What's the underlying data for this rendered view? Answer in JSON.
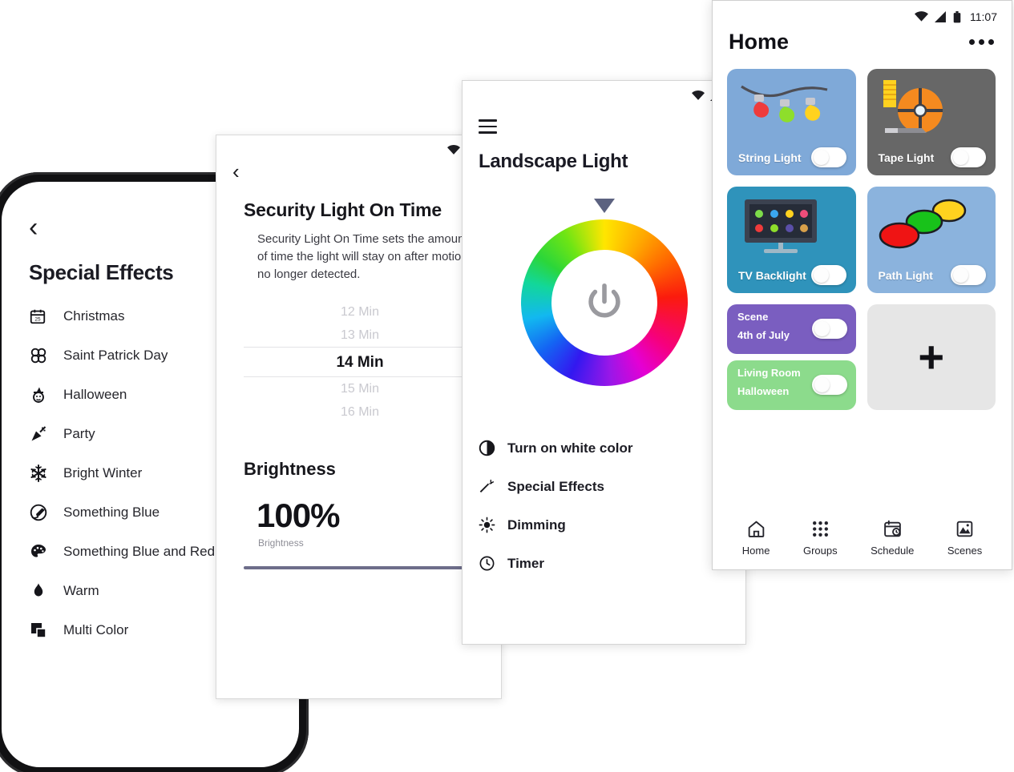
{
  "effects_screen": {
    "back_icon": "chevron-left-icon",
    "title": "Special Effects",
    "items": [
      {
        "icon": "calendar-icon",
        "label": "Christmas"
      },
      {
        "icon": "clover-icon",
        "label": "Saint Patrick Day"
      },
      {
        "icon": "witch-icon",
        "label": "Halloween"
      },
      {
        "icon": "party-popper-icon",
        "label": "Party"
      },
      {
        "icon": "snowflake-icon",
        "label": "Bright Winter"
      },
      {
        "icon": "paint-brush-circle-icon",
        "label": "Something Blue"
      },
      {
        "icon": "palette-icon",
        "label": "Something Blue and Red"
      },
      {
        "icon": "flame-icon",
        "label": "Warm"
      },
      {
        "icon": "layers-icon",
        "label": "Multi Color"
      }
    ]
  },
  "security_screen": {
    "status_icons": [
      "wifi-icon",
      "signal-icon",
      "battery-icon"
    ],
    "back_icon": "chevron-left-icon",
    "title": "Security Light On Time",
    "description": "Security Light On Time sets the amount of time the light will stay on after motion is no longer detected.",
    "picker": {
      "options": [
        "12 Min",
        "13 Min",
        "14 Min",
        "15 Min",
        "16 Min"
      ],
      "selected": "14 Min",
      "selected_index": 2
    },
    "brightness": {
      "heading": "Brightness",
      "value": "100%",
      "caption": "Brightness",
      "slider_percent": 100,
      "slider_color": "#6d6d8a"
    }
  },
  "landscape_screen": {
    "status_icons": [
      "wifi-icon",
      "signal-icon",
      "battery-icon"
    ],
    "menu_icon": "hamburger-icon",
    "title": "Landscape Light",
    "color_wheel": {
      "pointer_icon": "triangle-pointer-icon",
      "center_icon": "power-icon",
      "pointer_color": "#5c6280"
    },
    "menu": [
      {
        "icon": "contrast-icon",
        "label": "Turn on white color"
      },
      {
        "icon": "magic-wand-icon",
        "label": "Special Effects"
      },
      {
        "icon": "brightness-icon",
        "label": "Dimming"
      },
      {
        "icon": "clock-icon",
        "label": "Timer"
      }
    ]
  },
  "home_screen": {
    "status": {
      "icons": [
        "wifi-icon",
        "signal-icon",
        "battery-icon"
      ],
      "time": "11:07"
    },
    "title": "Home",
    "overflow_icon": "more-horizontal-icon",
    "devices": [
      {
        "name": "String Light",
        "art": "string-light-art",
        "bg": "#7fa9d8",
        "toggle": "off"
      },
      {
        "name": "Tape Light",
        "art": "tape-light-art",
        "bg": "#676767",
        "toggle": "off"
      },
      {
        "name": "TV Backlight",
        "art": "tv-backlight-art",
        "bg": "#2f93bb",
        "toggle": "off"
      },
      {
        "name": "Path Light",
        "art": "path-light-art",
        "bg": "#8bb3dd",
        "toggle": "off"
      }
    ],
    "scenes": [
      {
        "line1": "Scene",
        "line2": "4th of July",
        "bg": "#7a5ec0",
        "toggle": "off"
      },
      {
        "line1": "Living Room",
        "line2": "Halloween",
        "bg": "#8cdb8c",
        "toggle": "off"
      }
    ],
    "add_card": {
      "icon": "plus-icon",
      "label": "+"
    },
    "nav": [
      {
        "icon": "home-icon",
        "label": "Home"
      },
      {
        "icon": "grid-icon",
        "label": "Groups"
      },
      {
        "icon": "schedule-icon",
        "label": "Schedule"
      },
      {
        "icon": "scenes-icon",
        "label": "Scenes"
      }
    ]
  }
}
